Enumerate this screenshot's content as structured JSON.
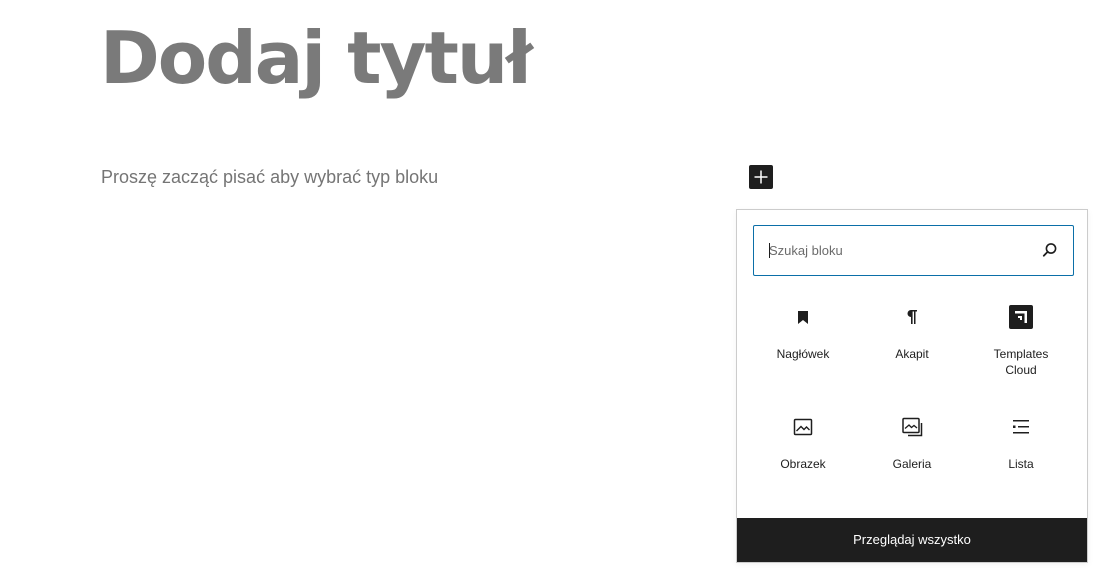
{
  "editor": {
    "title_placeholder": "Dodaj tytuł",
    "block_placeholder": "Proszę zacząć pisać aby wybrać typ bloku"
  },
  "inserter": {
    "search": {
      "placeholder": "Szukaj bloku",
      "value": ""
    },
    "blocks": [
      {
        "label": "Nagłówek",
        "icon": "bookmark-icon"
      },
      {
        "label": "Akapit",
        "icon": "paragraph-icon"
      },
      {
        "label": "Templates\nCloud",
        "icon": "templates-cloud-icon"
      },
      {
        "label": "Obrazek",
        "icon": "image-icon"
      },
      {
        "label": "Galeria",
        "icon": "gallery-icon"
      },
      {
        "label": "Lista",
        "icon": "list-icon"
      }
    ],
    "browse_all_label": "Przeglądaj wszystko"
  },
  "colors": {
    "focus_blue": "#0b6fa8",
    "dark": "#1e1e1e",
    "title_gray": "#7a7a7a"
  }
}
